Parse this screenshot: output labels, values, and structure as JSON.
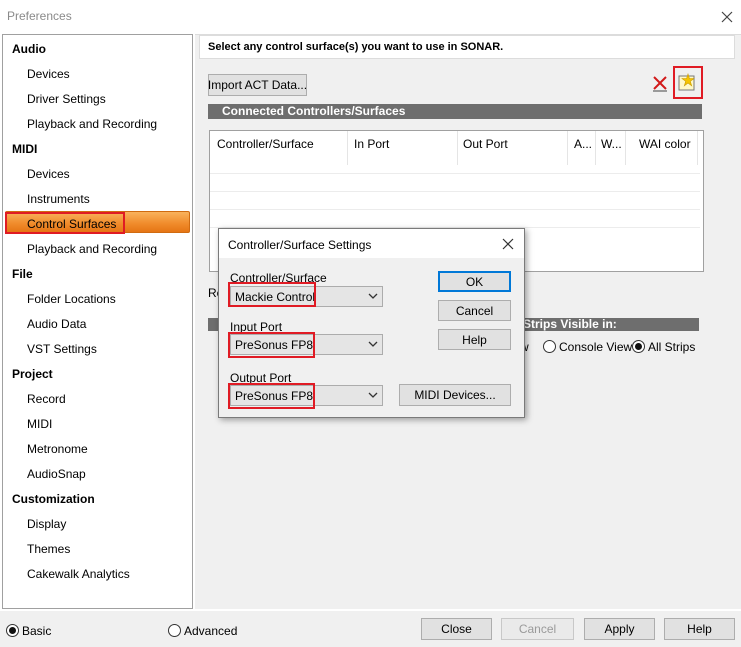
{
  "window": {
    "title": "Preferences"
  },
  "sidebar": {
    "categories": [
      {
        "label": "Audio",
        "items": [
          "Devices",
          "Driver Settings",
          "Playback and Recording"
        ]
      },
      {
        "label": "MIDI",
        "items": [
          "Devices",
          "Instruments",
          "Control Surfaces",
          "Playback and Recording"
        ]
      },
      {
        "label": "File",
        "items": [
          "Folder Locations",
          "Audio Data",
          "VST Settings"
        ]
      },
      {
        "label": "Project",
        "items": [
          "Record",
          "MIDI",
          "Metronome",
          "AudioSnap"
        ]
      },
      {
        "label": "Customization",
        "items": [
          "Display",
          "Themes",
          "Cakewalk Analytics"
        ]
      }
    ],
    "selected": "Control Surfaces"
  },
  "main": {
    "header": "Select any control surface(s) you want to use in SONAR.",
    "import_button": "Import ACT Data...",
    "connected_section": "Connected Controllers/Surfaces",
    "columns": [
      "Controller/Surface",
      "In Port",
      "Out Port",
      "A...",
      "W...",
      "WAI color"
    ],
    "partial_label": "Re",
    "strips_section_fragment": "Strips Visible in:",
    "strips_option_fragment": "w",
    "strips_options": [
      "Console View",
      "All Strips"
    ],
    "strips_selected": "All Strips"
  },
  "dialog": {
    "title": "Controller/Surface Settings",
    "controller_label": "Controller/Surface",
    "controller_value": "Mackie Control",
    "input_label": "Input Port",
    "input_value": "PreSonus FP8",
    "output_label": "Output Port",
    "output_value": "PreSonus FP8",
    "ok": "OK",
    "cancel": "Cancel",
    "help": "Help",
    "midi_devices": "MIDI Devices..."
  },
  "footer": {
    "mode_options": [
      "Basic",
      "Advanced"
    ],
    "mode_selected": "Basic",
    "buttons": [
      "Close",
      "Cancel",
      "Apply",
      "Help"
    ]
  },
  "colors": {
    "highlight": "#e01b24",
    "selection": "#f08a2a",
    "section_bar": "#6e6e6e"
  }
}
